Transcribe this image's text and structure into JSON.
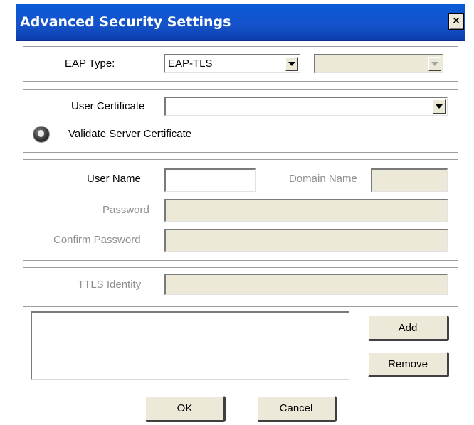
{
  "window": {
    "title": "Advanced Security Settings",
    "close_glyph": "×"
  },
  "eap": {
    "label": "EAP Type:",
    "value": "EAP-TLS",
    "secondary_value": ""
  },
  "certificate": {
    "user_certificate_label": "User Certificate",
    "user_certificate_value": "",
    "validate_server_label": "Validate Server Certificate"
  },
  "credentials": {
    "user_name_label": "User Name",
    "user_name_value": "",
    "domain_name_label": "Domain Name",
    "domain_name_value": "",
    "password_label": "Password",
    "password_value": "",
    "confirm_password_label": "Confirm Password",
    "confirm_password_value": ""
  },
  "ttls": {
    "identity_label": "TTLS Identity",
    "identity_value": ""
  },
  "server_list": {
    "items": [],
    "add_label": "Add",
    "remove_label": "Remove"
  },
  "footer": {
    "ok_label": "OK",
    "cancel_label": "Cancel"
  }
}
